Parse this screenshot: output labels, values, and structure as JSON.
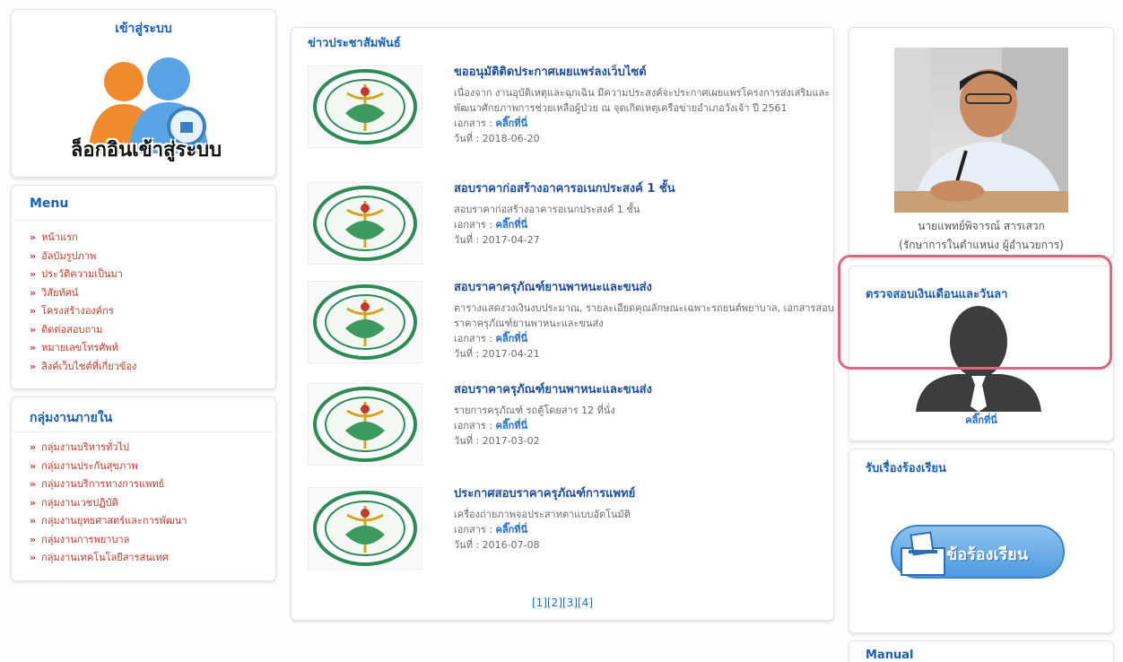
{
  "login": {
    "title": "เข้าสู่ระบบ",
    "banner_text": "ล็อกอินเข้าสู่ระบบ"
  },
  "menu": {
    "title": "Menu",
    "items": [
      "หน้าแรก",
      "อัลบัมรูปภาพ",
      "ประวัติความเป็นมา",
      "วิสัยทัศน์",
      "โครงสร้างองค์กร",
      "ติดต่อสอบถาม",
      "หมายเลขโทรศัพท์",
      "ลิงค์เว็บไซต์ที่เกี่ยวข้อง"
    ]
  },
  "groups": {
    "title": "กลุ่มงานภายใน",
    "items": [
      "กลุ่มงานบริหารทั่วไป",
      "กลุ่มงานประกันสุขภาพ",
      "กลุ่มงานบริการทางการแพทย์",
      "กลุ่มงานเวชปฏิบัติ",
      "กลุ่มงานยุทธศาสตร์และการพัฒนา",
      "กลุ่มงานการพยาบาล",
      "กลุ่มงานเทคโนโลยีสารสนเทศ"
    ]
  },
  "news": {
    "title": "ข่าวประชาสัมพันธ์",
    "doc_label": "เอกสาร :",
    "link_label": "คลิ๊กที่นี่",
    "date_label": "วันที่ :",
    "items": [
      {
        "title": "ขออนุมัติติดประกาศเผยแพร่ลงเว็บไซต์",
        "desc": "เนื่องจาก งานอุบัติเหตุและฉุกเฉิน มีความประสงค์จะประกาศเผยแพร่โครงการส่งเสริมและพัฒนาศักยภาพการช่วยเหลือผู้ป่วย ณ จุดเกิดเหตุเครือข่ายอำเภอวังเจ้า ปี 2561",
        "date": "2018-06-20"
      },
      {
        "title": "สอบราคาก่อสร้างอาคารอเนกประสงค์ 1 ชั้น",
        "desc": "สอบราคาก่อสร้างอาคารอเนกประสงค์ 1 ชั้น",
        "date": "2017-04-27"
      },
      {
        "title": "สอบราคาครุภัณฑ์ยานพาหนะและขนส่ง",
        "desc": "ตารางแสดงวงเงินงบประมาณ, รายละเอียดคุณลักษณะเฉพาะรถยนต์พยาบาล, เอกสารสอบราคาครุภัณฑ์ยานพาหนะและขนส่ง",
        "date": "2017-04-21"
      },
      {
        "title": "สอบราคาครุภัณฑ์ยานพาหนะและขนส่ง",
        "desc": "รายการครุภัณฑ์ รถตู้โดยสาร 12 ที่นั่ง",
        "date": "2017-03-02"
      },
      {
        "title": "ประกาศสอบราคาครุภัณฑ์การแพทย์",
        "desc": "เครื่องถ่ายภาพจอประสาทตาแบบอัตโนมัติ",
        "date": "2016-07-08"
      }
    ],
    "pagination": [
      "[1]",
      "[2]",
      "[3]",
      "[4]"
    ]
  },
  "director": {
    "name": "นายแพทย์พิจารณ์ สารเสวก",
    "position": "(รักษาการในตำแหน่ง ผู้อำนวยการ)"
  },
  "salary": {
    "title": "ตรวจสอบเงินเดือนและวันลา",
    "link": "คลิ๊กที่นี่"
  },
  "complaint": {
    "title": "รับเรื่องร้องเรียน",
    "button": "ข้อร้องเรียน"
  },
  "manual": {
    "title": "Manual"
  },
  "colors": {
    "title_blue": "#1a5fb4",
    "menu_red": "#c0392b",
    "highlight_pink": "#e0667f",
    "logo_green": "#2e8b57"
  }
}
